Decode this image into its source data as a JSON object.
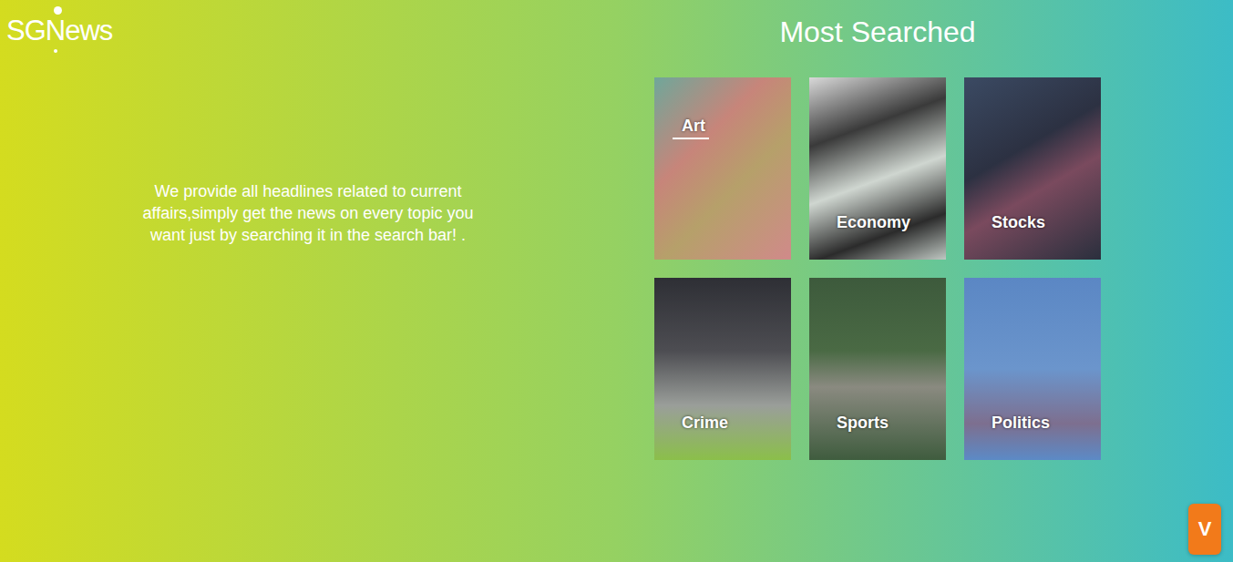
{
  "logo": {
    "text": "SGNews"
  },
  "intro": {
    "text": "We provide all headlines related to current affairs,simply get the news on every topic you want just by searching it in the search bar! ."
  },
  "most_searched": {
    "title": "Most Searched",
    "tiles": [
      {
        "label": "Art",
        "hovered": true
      },
      {
        "label": "Economy",
        "hovered": false
      },
      {
        "label": "Stocks",
        "hovered": false
      },
      {
        "label": "Crime",
        "hovered": false
      },
      {
        "label": "Sports",
        "hovered": false
      },
      {
        "label": "Politics",
        "hovered": false
      }
    ]
  },
  "floating_button": {
    "label": "V"
  }
}
